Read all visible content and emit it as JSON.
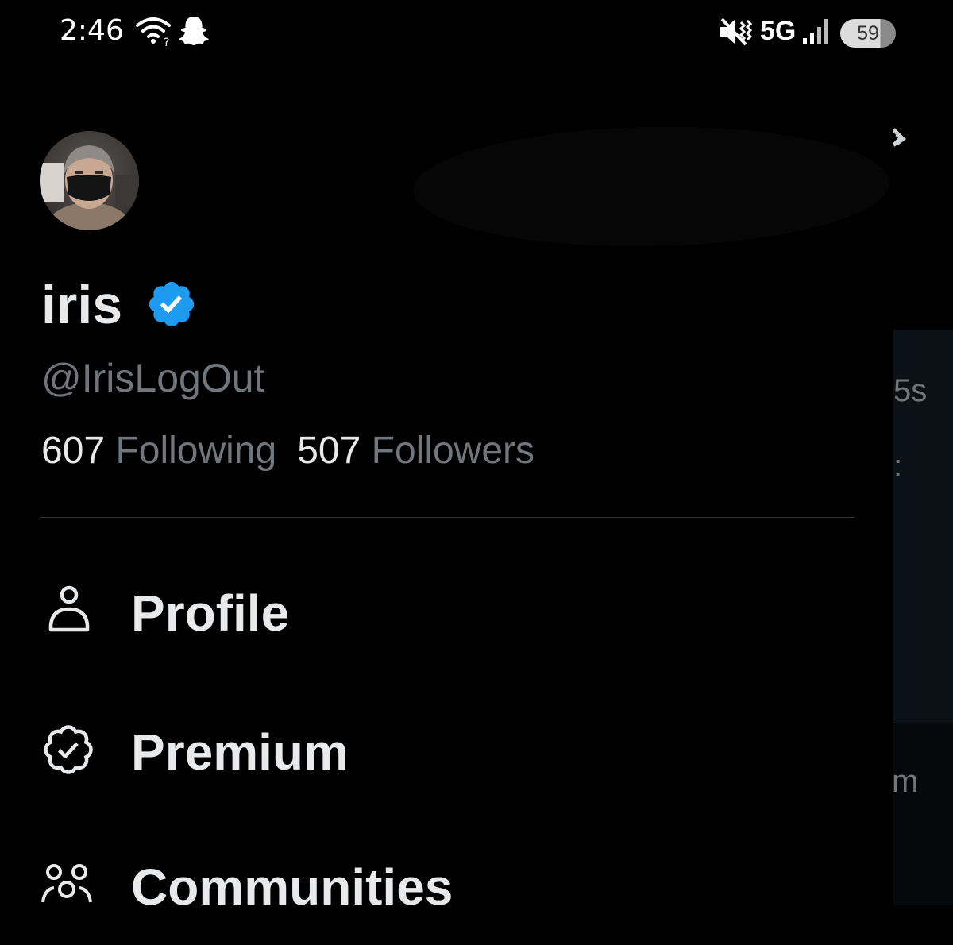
{
  "status_bar": {
    "time": "2:46",
    "network": "5G",
    "battery": "59",
    "icons": [
      "wifi-icon",
      "snapchat-icon",
      "vibrate-icon",
      "signal-icon",
      "battery-icon"
    ]
  },
  "profile": {
    "name": "iris",
    "handle": "@IrisLogOut",
    "following_count": "607",
    "following_label": "Following",
    "followers_count": "507",
    "followers_label": "Followers",
    "verified": true,
    "verified_color": "#1d9bf0"
  },
  "menu": {
    "items": [
      {
        "label": "Profile",
        "icon": "person-icon"
      },
      {
        "label": "Premium",
        "icon": "verified-outline-icon"
      },
      {
        "label": "Communities",
        "icon": "communities-icon"
      }
    ]
  },
  "background_app": {
    "fragments": [
      "5s",
      ":",
      "m"
    ]
  },
  "colors": {
    "background": "#000000",
    "primary_text": "#e7e9ea",
    "secondary_text": "#71767b",
    "accent": "#1d9bf0",
    "divider": "#2f3336"
  }
}
